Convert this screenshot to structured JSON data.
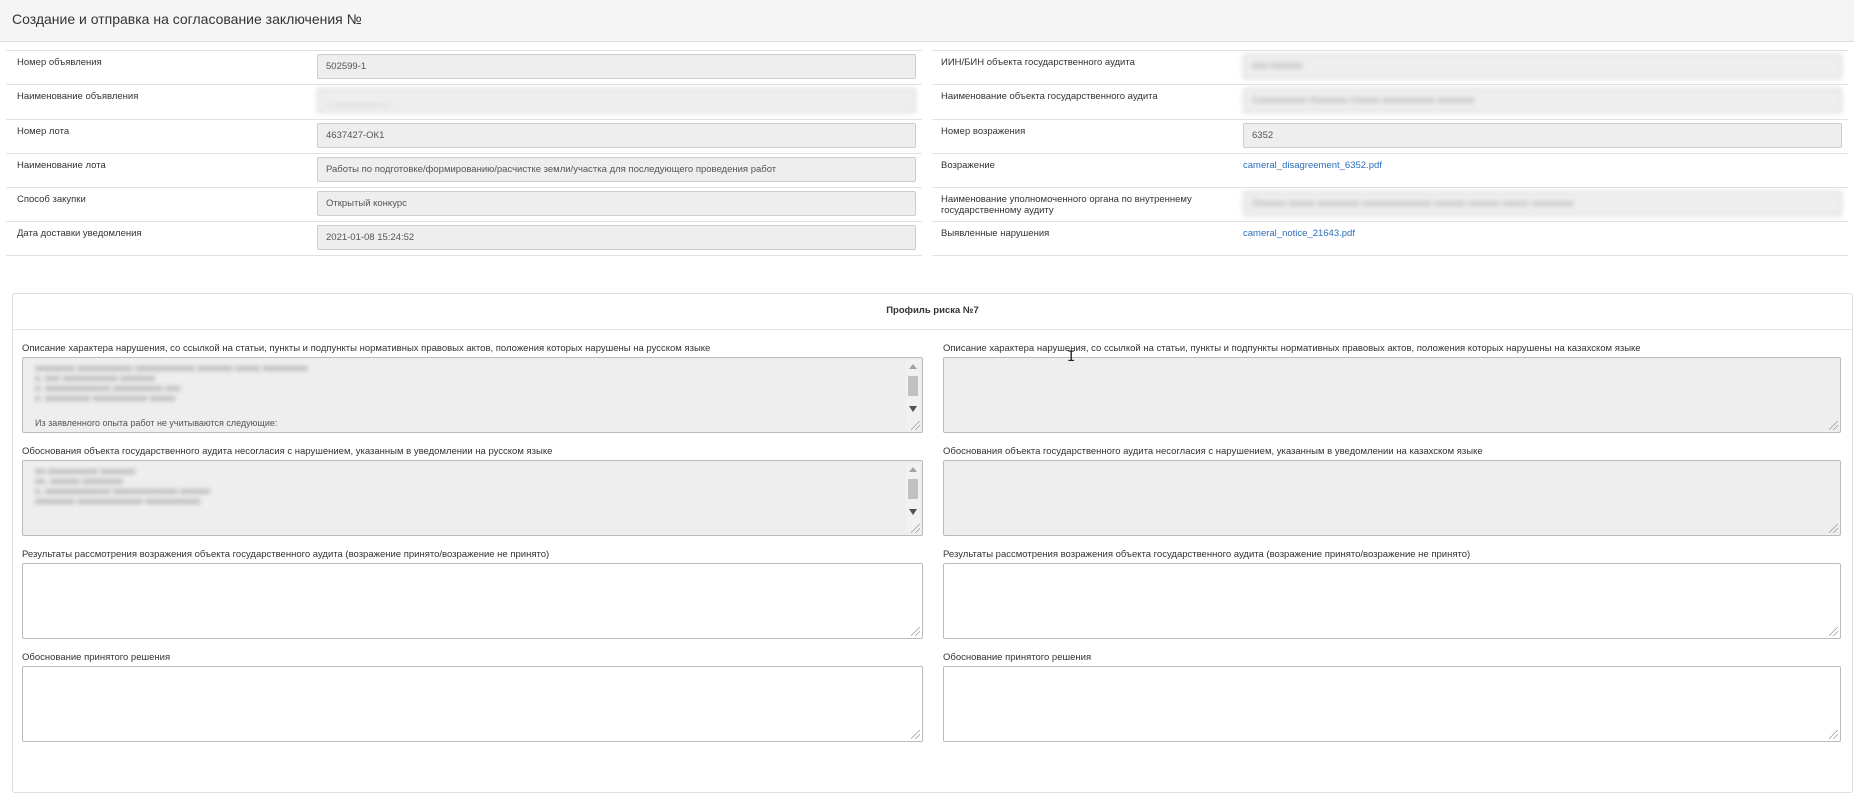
{
  "header": {
    "title": "Создание и отправка на согласование заключения №"
  },
  "info": {
    "left": [
      {
        "label": "Номер объявления",
        "value": "502599-1",
        "blurred": false
      },
      {
        "label": "Наименование объявления",
        "value": "_ _________ _",
        "blurred": true
      },
      {
        "label": "Номер лота",
        "value": "4637427-ОК1",
        "blurred": false
      },
      {
        "label": "Наименование лота",
        "value": "Работы по подготовке/формированию/расчистке земли/участка для последующего проведения работ",
        "blurred": false
      },
      {
        "label": "Способ закупки",
        "value": "Открытый конкурс",
        "blurred": false
      },
      {
        "label": "Дата доставки уведомления",
        "value": "2021-01-08 15:24:52",
        "blurred": false
      }
    ],
    "right": [
      {
        "label": "ИИН/БИН объекта государственного аудита",
        "value": "000 000000",
        "blurred": true,
        "type": "input"
      },
      {
        "label": "Наименование объекта государственного аудита",
        "value": "Сооооооооо Ооооооо Ооооо оооооооооо ооооооо",
        "blurred": true,
        "type": "input"
      },
      {
        "label": "Номер возражения",
        "value": "6352",
        "blurred": false,
        "type": "input"
      },
      {
        "label": "Возражение",
        "value": "cameral_disagreement_6352.pdf",
        "blurred": false,
        "type": "link"
      },
      {
        "label": "Наименование уполномоченного органа по внутреннему государственному аудиту",
        "value": "Оооооо ооооо оооооооо ооооооооооооо оооооо оооооо ооооо оооооооо",
        "blurred": true,
        "type": "input"
      },
      {
        "label": "Выявленные нарушения",
        "value": "cameral_notice_21643.pdf",
        "blurred": false,
        "type": "link"
      }
    ]
  },
  "panel": {
    "title": "Профиль риска №7",
    "fields": [
      {
        "label": "Описание характера нарушения, со ссылкой на статьи, пункты и подпункты нормативных правовых актов, положения которых нарушены на русском языке",
        "readonly": true,
        "scroll": true,
        "lines": [
          "оооооооо ооооооооооо оооооооооооо ооооооо ооооо ооооооооо",
          "о. ооо ооооооооооо ооооооо",
          "о. ооооооооооооо оооооооооо ооо",
          "о. ооооооооо ооооооооооо ооооо"
        ],
        "visible_line": "Из заявленного опыта работ не учитываются следующие:"
      },
      {
        "label": "Описание характера нарушения, со ссылкой на статьи, пункты и подпункты нормативных правовых актов, положения которых нарушены на казахском языке",
        "readonly": true,
        "scroll": false,
        "lines": [],
        "visible_line": ""
      },
      {
        "label": "Обоснования объекта государственного аудита несогласия с нарушением, указанным в уведомлении на русском языке",
        "readonly": true,
        "scroll": true,
        "lines": [
          "оо оооооооооо ооооооо",
          "оо. оооооо оооооооо",
          "о. ооооооооооооо ооооооооооооо оооооо",
          "оооооооо ооооооооооооо ооооооооооо"
        ],
        "visible_line": ""
      },
      {
        "label": "Обоснования объекта государственного аудита несогласия с нарушением, указанным в уведомлении на казахском языке",
        "readonly": true,
        "scroll": false,
        "lines": [],
        "visible_line": ""
      },
      {
        "label": "Результаты рассмотрения возражения объекта государственного аудита (возражение принято/возражение не принято)",
        "readonly": false,
        "scroll": false,
        "lines": [],
        "visible_line": ""
      },
      {
        "label": "Результаты рассмотрения возражения объекта государственного аудита (возражение принято/возражение не принято)",
        "readonly": false,
        "scroll": false,
        "lines": [],
        "visible_line": ""
      },
      {
        "label": "Обоснование принятого решения",
        "readonly": false,
        "scroll": false,
        "lines": [],
        "visible_line": ""
      },
      {
        "label": "Обоснование принятого решения",
        "readonly": false,
        "scroll": false,
        "lines": [],
        "visible_line": ""
      }
    ]
  },
  "cursor": {
    "glyph": "I"
  },
  "colors": {
    "link": "#2a6ebb",
    "readonly_bg": "#eeeeee",
    "header_bg": "#f5f5f5"
  }
}
